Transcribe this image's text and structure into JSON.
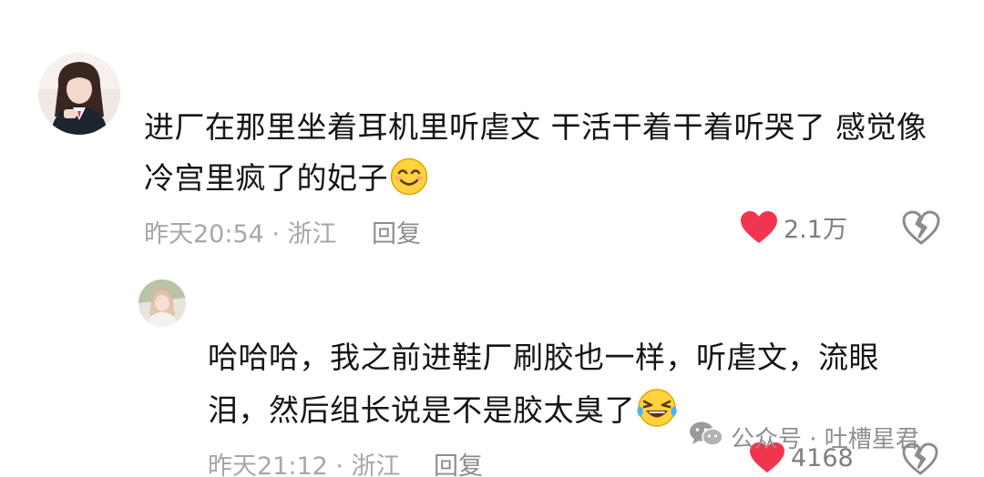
{
  "comment": {
    "lines": [
      "进厂在那里坐着耳机里听虐文 干活干着干着听哭了 感觉像",
      "冷宫里疯了的妃子"
    ],
    "emoji": "smiling-face-emoji",
    "meta": "昨天20:54 · 浙江",
    "reply_label": "回复",
    "likes": "2.1万"
  },
  "reply": {
    "lines": [
      "哈哈哈，我之前进鞋厂刷胶也一样，听虐文，流眼",
      "泪，然后组长说是不是胶太臭了"
    ],
    "emoji": "rolling-laughing-emoji",
    "meta": "昨天21:12 · 浙江",
    "reply_label": "回复",
    "likes": "4168"
  },
  "watermark": {
    "text": "公众号 · 吐槽星君",
    "icon": "wechat-icon"
  },
  "colors": {
    "like_red": "#f2354f",
    "meta_gray": "#a7a7a7",
    "text": "#151515",
    "dislike_outline": "#8c8c8c"
  }
}
